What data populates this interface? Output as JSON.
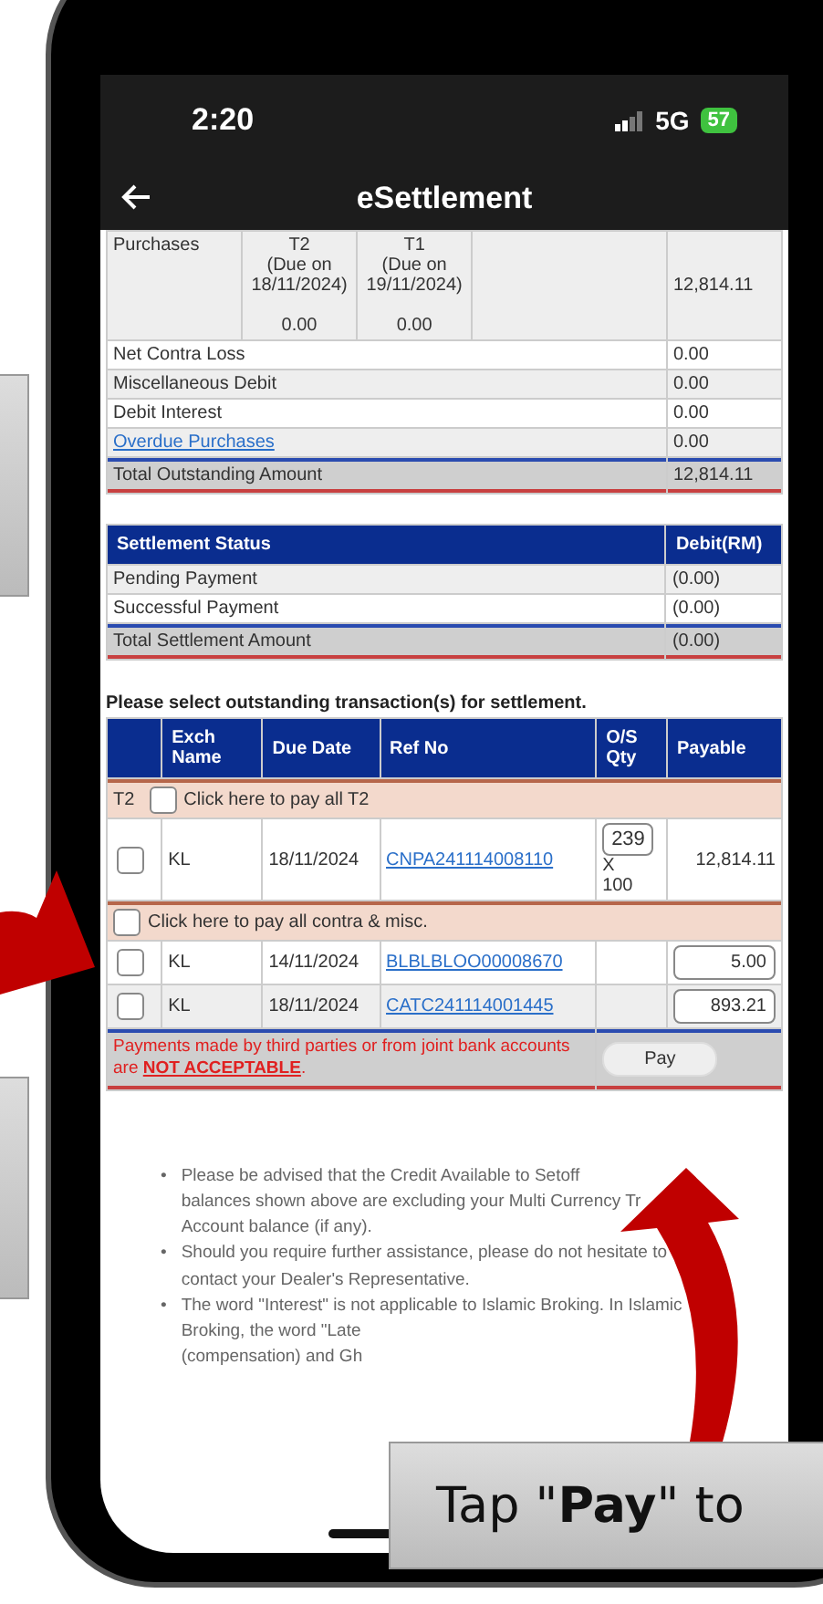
{
  "status_bar": {
    "time": "2:20",
    "network": "5G",
    "battery": "57"
  },
  "header": {
    "title": "eSettlement"
  },
  "summary": {
    "purchases": {
      "label": "Purchases",
      "columns": [
        {
          "tag": "T2",
          "due": "(Due on 18/11/2024)",
          "amount": "0.00"
        },
        {
          "tag": "T1",
          "due": "(Due on 19/11/2024)",
          "amount": "0.00"
        }
      ],
      "total": "12,814.11"
    },
    "rows": [
      {
        "label": "Net Contra Loss",
        "value": "0.00",
        "link": false
      },
      {
        "label": "Miscellaneous Debit",
        "value": "0.00",
        "link": false
      },
      {
        "label": "Debit Interest",
        "value": "0.00",
        "link": false
      },
      {
        "label": "Overdue Purchases",
        "value": "0.00",
        "link": true
      }
    ],
    "total": {
      "label": "Total Outstanding Amount",
      "value": "12,814.11"
    }
  },
  "settlement": {
    "columns": [
      "Settlement Status",
      "Debit(RM)"
    ],
    "rows": [
      {
        "label": "Pending Payment",
        "value": "(0.00)"
      },
      {
        "label": "Successful Payment",
        "value": "(0.00)"
      }
    ],
    "total": {
      "label": "Total Settlement Amount",
      "value": "(0.00)"
    }
  },
  "instruction": "Please select outstanding transaction(s) for settlement.",
  "transactions": {
    "columns": [
      "Exch Name",
      "Due Date",
      "Ref No",
      "O/S Qty",
      "Payable"
    ],
    "groups": [
      {
        "tag": "T2",
        "label": "Click here to pay all T2",
        "checked": false,
        "rows": [
          {
            "checked": false,
            "exch": "KL",
            "due": "18/11/2024",
            "ref": "CNPA241114008110",
            "qty": "239",
            "qty_sep": "X",
            "lot": "100",
            "payable": "12,814.11",
            "kind": "fixed"
          }
        ]
      },
      {
        "label": "Click here to pay all contra & misc.",
        "checked": false,
        "rows": [
          {
            "checked": false,
            "exch": "KL",
            "due": "14/11/2024",
            "ref": "BLBLBLOO00008670",
            "payable": "5.00",
            "kind": "input"
          },
          {
            "checked": false,
            "exch": "KL",
            "due": "18/11/2024",
            "ref": "CATC241114001445",
            "payable": "893.21",
            "kind": "input"
          }
        ]
      }
    ],
    "warning": {
      "text": "Payments made by third parties or from joint bank accounts are",
      "emphasis": "NOT ACCEPTABLE",
      "end": "."
    },
    "pay_button": "Pay"
  },
  "notes": [
    {
      "bullet": "•",
      "lines": [
        "Please be advised that the Credit Available to Setoff",
        "balances shown above are excluding your Multi Currency Tr",
        "Account balance (if any)."
      ]
    },
    {
      "bullet": "•",
      "lines": [
        "Should you require further assistance, please do not hesitate to",
        "contact your Dealer's Representative."
      ]
    },
    {
      "bullet": "•",
      "lines": [
        "The word \"Interest\" is not applicable to Islamic Broking. In Islamic",
        "Broking, the word \"Late",
        "(compensation) and Gh"
      ]
    }
  ],
  "callout": "Tap \"**Pay**\" to"
}
